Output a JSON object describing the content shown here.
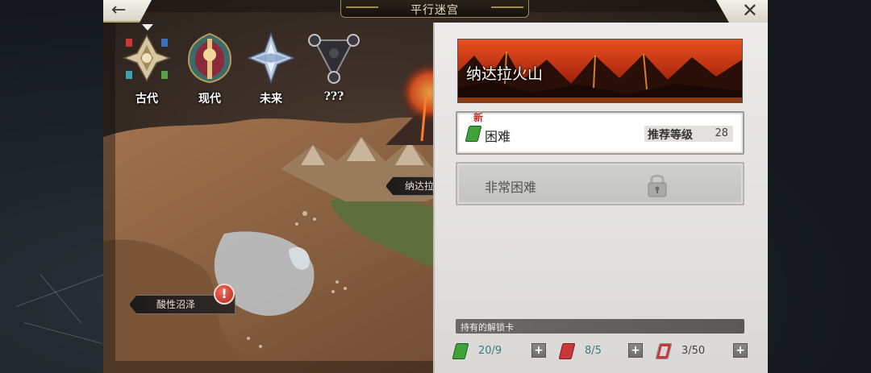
{
  "header": {
    "title": "平行迷宫",
    "back_icon": "back-arrow-icon",
    "close_icon": "close-icon"
  },
  "eras": [
    {
      "label": "古代",
      "icon": "ancient-era-icon",
      "selected": true
    },
    {
      "label": "现代",
      "icon": "modern-era-icon",
      "selected": false
    },
    {
      "label": "未来",
      "icon": "future-era-icon",
      "selected": false
    },
    {
      "label": "???",
      "icon": "unknown-era-icon",
      "selected": false
    }
  ],
  "map": {
    "locations": [
      {
        "label": "纳达拉火山"
      },
      {
        "label": "酸性沼泽"
      }
    ],
    "alert_symbol": "!"
  },
  "panel": {
    "location_name": "纳达拉火山",
    "difficulties": [
      {
        "label": "困难",
        "new_badge": "新",
        "recommend_label": "推荐等级",
        "recommend_level": "28",
        "locked": false,
        "card_color": "#3fa33a"
      },
      {
        "label": "非常困难",
        "locked": true
      }
    ],
    "keys_title": "持有的解锁卡",
    "keys": [
      {
        "count": "20/9",
        "color": "#3fa33a"
      },
      {
        "count": "8/5",
        "color": "#c8383a"
      },
      {
        "count": "3/50",
        "color": "#d7d7d7"
      }
    ],
    "plus_symbol": "+"
  },
  "colors": {
    "accent_gold": "#a08a4e",
    "count_teal": "#3a7d7a",
    "new_red": "#c4302a"
  }
}
